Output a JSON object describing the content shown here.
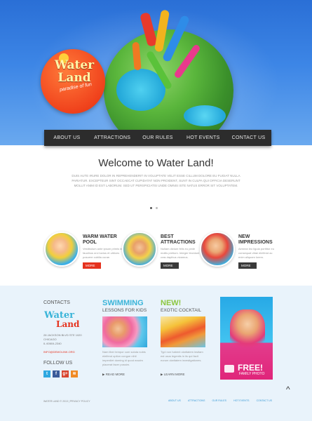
{
  "logo": {
    "title": "Water Land",
    "tagline": "paradise of fun"
  },
  "nav": [
    "ABOUT US",
    "ATTRACTIONS",
    "OUR RULES",
    "HOT EVENTS",
    "CONTACT US"
  ],
  "welcome": {
    "title": "Welcome to Water Land!",
    "text": "Duis aute irure dolor in reprehenderit in voluptate velit esse cillum dolore eu fugiat nulla pariatur. Excepteur sint occaecat cupidatat non proident, sunt in culpa qui officia deserunt mollit anim id est laborum. Sed ut perspiciatis unde omnis iste natus error sit voluptatem."
  },
  "slider": {
    "active_index": 0,
    "count": 3
  },
  "features": [
    {
      "title": "WARM WATER POOL",
      "text": "Vestibulum ante ipsum primis in faucibus orci luctus et ultrices posuere cubilia curae.",
      "more": "MORE",
      "style": "red"
    },
    {
      "title": "BEST ATTRACTIONS",
      "text": "Nullam dictum felis eu pede mollis pretium. Integer tincidunt cras dapibus vivamus.",
      "more": "MORE",
      "style": "dark"
    },
    {
      "title": "NEW IMPRESSIONS",
      "text": "Aenean leo ligula porttitor eu consequat vitae eleifend ac enim aliquam lorem.",
      "more": "MORE",
      "style": "dark"
    }
  ],
  "contacts": {
    "title": "CONTACTS",
    "logo_top": "Water",
    "logo_bottom": "Land",
    "address": [
      "28 JACKSON BLVD STE 1020",
      "CHICAGO",
      "IL 60604-2340"
    ],
    "email": "INFO@DEMOLINK.ORG"
  },
  "follow": {
    "title": "FOLLOW US",
    "icons": [
      "twitter-icon",
      "facebook-icon",
      "googleplus-icon",
      "rss-icon"
    ],
    "glyphs": [
      "t",
      "f",
      "g+",
      "≋"
    ]
  },
  "promos": [
    {
      "title": "SWIMMING",
      "sub": "LESSONS FOR KIDS",
      "text": "Nam liber tempor cum soluta nobis eleifend option congue nihil imperdiet doming id quod mazim placerat facer possim.",
      "read_more": "READ MORE",
      "color": "#3ab4d8"
    },
    {
      "title": "NEW!",
      "sub": "EXOTIC COCKTAIL",
      "text": "Typi non habent claritatem insitam est usus legentis in iis qui facit eorum claritatem investigationes.",
      "read_more": "LEARN MORE",
      "color": "#8cc63f"
    }
  ],
  "free_box": {
    "label": "FREE!",
    "sub": "FAMILY PHOTO"
  },
  "footer": {
    "copyright": "WATER LAND © 2013  |  PRIVACY POLICY",
    "links": [
      "ABOUT US",
      "ATTRACTIONS",
      "OUR RULES",
      "HOT EVENTS",
      "CONTACT US"
    ]
  },
  "colors": {
    "accent": "#e5321e",
    "nav_bg": "#2c2c2c",
    "hero_bg": "#3d86e6",
    "footer_bg": "#e9f3fb"
  }
}
